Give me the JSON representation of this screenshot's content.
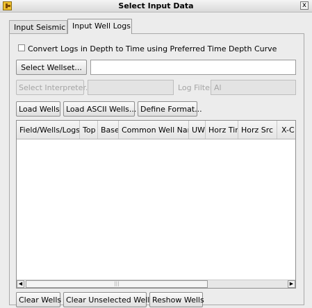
{
  "window": {
    "title": "Select Input Data",
    "close_label": "x"
  },
  "tabs": [
    {
      "label": "Input Seismic",
      "active": false
    },
    {
      "label": "Input Well Logs",
      "active": true
    }
  ],
  "convert_checkbox": {
    "label": "Convert Logs in Depth to Time using Preferred Time Depth Curve",
    "checked": false
  },
  "wellset": {
    "button_label": "Select Wellset...",
    "value": ""
  },
  "interpreter": {
    "button_label": "Select Interpreter...",
    "value": ""
  },
  "log_filter": {
    "label": "Log Filter",
    "value": "Al"
  },
  "actions": {
    "load_wells": "Load Wells",
    "load_ascii": "Load ASCII Wells...",
    "define_format": "Define Format..."
  },
  "table": {
    "columns": [
      "Field/Wells/Logs",
      "Top",
      "Base",
      "Common Well Nam",
      "UWI",
      "Horz Tin",
      "Horz Src",
      "X-C"
    ],
    "rows": []
  },
  "footer": {
    "clear_wells": "Clear Wells",
    "clear_unselected": "Clear Unselected Wells",
    "reshow_wells": "Reshow Wells"
  }
}
